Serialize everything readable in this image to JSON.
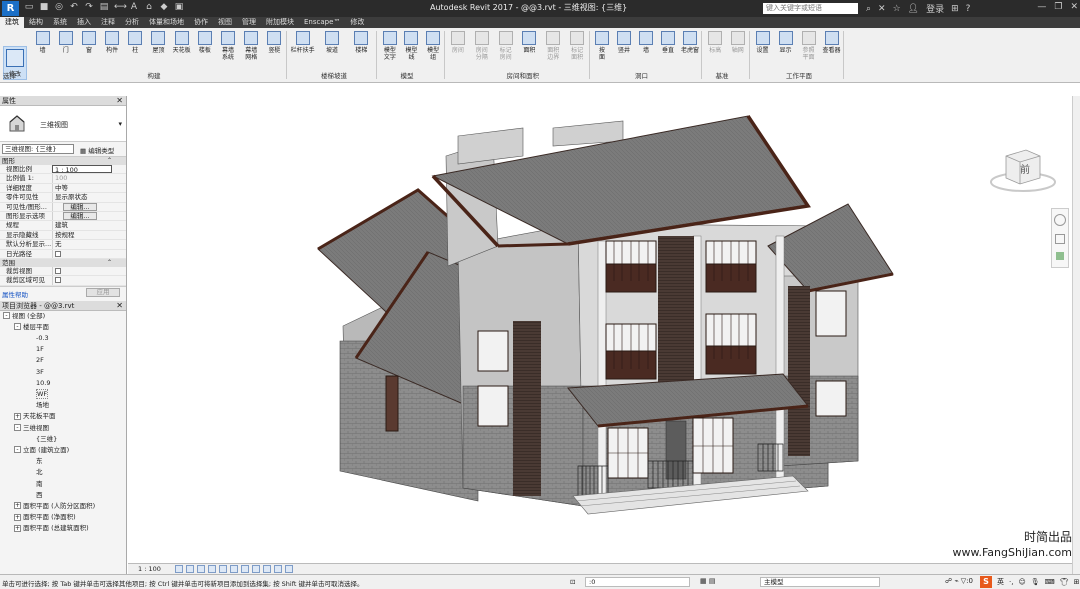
{
  "titlebar": {
    "logo": "R",
    "title": "Autodesk Revit 2017 -    @@3.rvt - 三维视图: {三维}",
    "search_placeholder": "键入关键字或短语",
    "login": "登录",
    "right_icons": [
      "search-icon",
      "exchange-icon",
      "star-icon",
      "user-icon",
      "cart-icon",
      "help-icon"
    ]
  },
  "tabs": [
    "建筑",
    "结构",
    "系统",
    "插入",
    "注释",
    "分析",
    "体量和场地",
    "协作",
    "视图",
    "管理",
    "附加模块",
    "Enscape™",
    "修改"
  ],
  "active_tab": "建筑",
  "ribbon": {
    "modify": "修改",
    "select_label": "选择",
    "panels": [
      {
        "label": "构建",
        "buttons": [
          "墙",
          "门",
          "窗",
          "构件",
          "柱",
          "屋顶",
          "天花板",
          "楼板",
          "幕墙\n系统",
          "幕墙\n网格",
          "竖梃"
        ]
      },
      {
        "label": "楼梯坡道",
        "buttons": [
          "栏杆扶手",
          "坡道",
          "楼梯"
        ]
      },
      {
        "label": "模型",
        "buttons": [
          "模型\n文字",
          "模型\n线",
          "模型\n组"
        ]
      },
      {
        "label": "房间和面积",
        "buttons": [
          "房间",
          "房间\n分隔",
          "标记\n房间",
          "面积",
          "面积\n边界",
          "标记\n面积"
        ]
      },
      {
        "label": "洞口",
        "buttons": [
          "按\n面",
          "竖井",
          "墙",
          "垂直",
          "老虎窗"
        ]
      },
      {
        "label": "基准",
        "buttons": [
          "标高",
          "轴网"
        ]
      },
      {
        "label": "工作平面",
        "buttons": [
          "设置",
          "显示",
          "参照\n平面",
          "查看器"
        ]
      }
    ]
  },
  "properties": {
    "header": "属性",
    "type_name": "三维视图",
    "view_selector": "三维视图: {三维}",
    "edit_type": "编辑类型",
    "group_graphics": "图形",
    "rows": [
      {
        "k": "视图比例",
        "v": "1 : 100"
      },
      {
        "k": "比例值 1:",
        "v": "100"
      },
      {
        "k": "详细程度",
        "v": "中等"
      },
      {
        "k": "零件可见性",
        "v": "显示原状态"
      },
      {
        "k": "可见性/图形...",
        "v": "编辑..."
      },
      {
        "k": "图形显示选项",
        "v": "编辑..."
      },
      {
        "k": "规程",
        "v": "建筑"
      },
      {
        "k": "显示隐藏线",
        "v": "按规程"
      },
      {
        "k": "默认分析显示...",
        "v": "无"
      },
      {
        "k": "日光路径",
        "v": ""
      }
    ],
    "group_extents": "范围",
    "extent_rows": [
      {
        "k": "裁剪视图",
        "v": ""
      },
      {
        "k": "裁剪区域可见",
        "v": ""
      }
    ],
    "help_link": "属性帮助",
    "apply": "应用"
  },
  "browser": {
    "header": "项目浏览器 - @@3.rvt",
    "items": [
      {
        "level": 0,
        "tg": "-",
        "text": "视图 (全部)"
      },
      {
        "level": 1,
        "tg": "-",
        "text": "楼层平面"
      },
      {
        "level": 2,
        "tg": "",
        "text": "-0.3"
      },
      {
        "level": 2,
        "tg": "",
        "text": "1F"
      },
      {
        "level": 2,
        "tg": "",
        "text": "2F"
      },
      {
        "level": 2,
        "tg": "",
        "text": "3F"
      },
      {
        "level": 2,
        "tg": "",
        "text": "10.9"
      },
      {
        "level": 2,
        "tg": "",
        "text": "WF"
      },
      {
        "level": 2,
        "tg": "",
        "text": "场地"
      },
      {
        "level": 1,
        "tg": "+",
        "text": "天花板平面"
      },
      {
        "level": 1,
        "tg": "-",
        "text": "三维视图"
      },
      {
        "level": 2,
        "tg": "",
        "text": "{三维}"
      },
      {
        "level": 1,
        "tg": "-",
        "text": "立面 (建筑立面)"
      },
      {
        "level": 2,
        "tg": "",
        "text": "东"
      },
      {
        "level": 2,
        "tg": "",
        "text": "北"
      },
      {
        "level": 2,
        "tg": "",
        "text": "南"
      },
      {
        "level": 2,
        "tg": "",
        "text": "西"
      },
      {
        "level": 1,
        "tg": "+",
        "text": "面积平面 (人防分区面积)"
      },
      {
        "level": 1,
        "tg": "+",
        "text": "面积平面 (净面积)"
      },
      {
        "level": 1,
        "tg": "+",
        "text": "面积平面 (总建筑面积)"
      }
    ]
  },
  "canvas": {
    "viewcube_face": "前",
    "watermark_line1": "时简出品",
    "watermark_line2": "www.FangShiJian.com"
  },
  "viewbar": {
    "scale": "1 : 100"
  },
  "statusbar": {
    "message": "单击可进行选择; 按 Tab 键并单击可选择其他项目; 按 Ctrl 键并单击可将新项目添加到选择集; 按 Shift 键并单击可取消选择。",
    "zero": ":0",
    "model": "主模型",
    "ime_label": "英"
  }
}
